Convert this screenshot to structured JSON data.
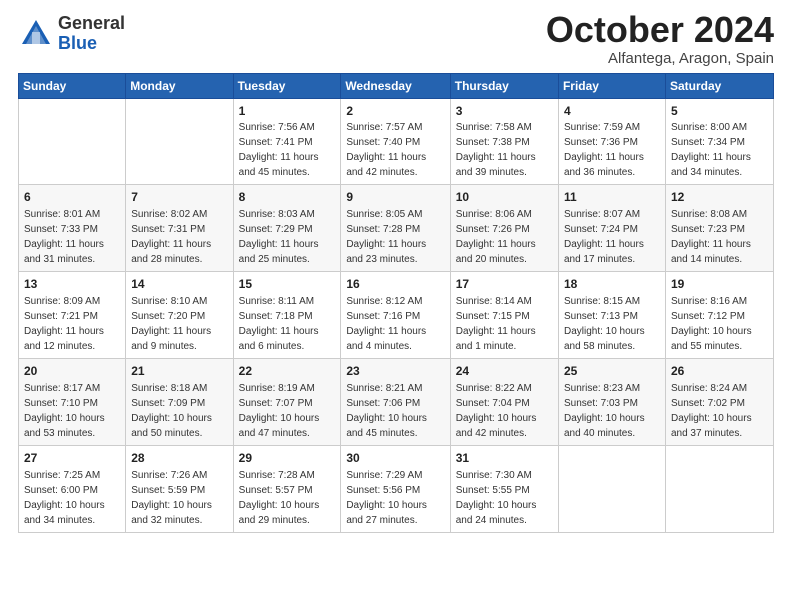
{
  "logo": {
    "general": "General",
    "blue": "Blue"
  },
  "header": {
    "month": "October 2024",
    "location": "Alfantega, Aragon, Spain"
  },
  "days_of_week": [
    "Sunday",
    "Monday",
    "Tuesday",
    "Wednesday",
    "Thursday",
    "Friday",
    "Saturday"
  ],
  "weeks": [
    [
      {
        "day": "",
        "info": ""
      },
      {
        "day": "",
        "info": ""
      },
      {
        "day": "1",
        "info": "Sunrise: 7:56 AM\nSunset: 7:41 PM\nDaylight: 11 hours and 45 minutes."
      },
      {
        "day": "2",
        "info": "Sunrise: 7:57 AM\nSunset: 7:40 PM\nDaylight: 11 hours and 42 minutes."
      },
      {
        "day": "3",
        "info": "Sunrise: 7:58 AM\nSunset: 7:38 PM\nDaylight: 11 hours and 39 minutes."
      },
      {
        "day": "4",
        "info": "Sunrise: 7:59 AM\nSunset: 7:36 PM\nDaylight: 11 hours and 36 minutes."
      },
      {
        "day": "5",
        "info": "Sunrise: 8:00 AM\nSunset: 7:34 PM\nDaylight: 11 hours and 34 minutes."
      }
    ],
    [
      {
        "day": "6",
        "info": "Sunrise: 8:01 AM\nSunset: 7:33 PM\nDaylight: 11 hours and 31 minutes."
      },
      {
        "day": "7",
        "info": "Sunrise: 8:02 AM\nSunset: 7:31 PM\nDaylight: 11 hours and 28 minutes."
      },
      {
        "day": "8",
        "info": "Sunrise: 8:03 AM\nSunset: 7:29 PM\nDaylight: 11 hours and 25 minutes."
      },
      {
        "day": "9",
        "info": "Sunrise: 8:05 AM\nSunset: 7:28 PM\nDaylight: 11 hours and 23 minutes."
      },
      {
        "day": "10",
        "info": "Sunrise: 8:06 AM\nSunset: 7:26 PM\nDaylight: 11 hours and 20 minutes."
      },
      {
        "day": "11",
        "info": "Sunrise: 8:07 AM\nSunset: 7:24 PM\nDaylight: 11 hours and 17 minutes."
      },
      {
        "day": "12",
        "info": "Sunrise: 8:08 AM\nSunset: 7:23 PM\nDaylight: 11 hours and 14 minutes."
      }
    ],
    [
      {
        "day": "13",
        "info": "Sunrise: 8:09 AM\nSunset: 7:21 PM\nDaylight: 11 hours and 12 minutes."
      },
      {
        "day": "14",
        "info": "Sunrise: 8:10 AM\nSunset: 7:20 PM\nDaylight: 11 hours and 9 minutes."
      },
      {
        "day": "15",
        "info": "Sunrise: 8:11 AM\nSunset: 7:18 PM\nDaylight: 11 hours and 6 minutes."
      },
      {
        "day": "16",
        "info": "Sunrise: 8:12 AM\nSunset: 7:16 PM\nDaylight: 11 hours and 4 minutes."
      },
      {
        "day": "17",
        "info": "Sunrise: 8:14 AM\nSunset: 7:15 PM\nDaylight: 11 hours and 1 minute."
      },
      {
        "day": "18",
        "info": "Sunrise: 8:15 AM\nSunset: 7:13 PM\nDaylight: 10 hours and 58 minutes."
      },
      {
        "day": "19",
        "info": "Sunrise: 8:16 AM\nSunset: 7:12 PM\nDaylight: 10 hours and 55 minutes."
      }
    ],
    [
      {
        "day": "20",
        "info": "Sunrise: 8:17 AM\nSunset: 7:10 PM\nDaylight: 10 hours and 53 minutes."
      },
      {
        "day": "21",
        "info": "Sunrise: 8:18 AM\nSunset: 7:09 PM\nDaylight: 10 hours and 50 minutes."
      },
      {
        "day": "22",
        "info": "Sunrise: 8:19 AM\nSunset: 7:07 PM\nDaylight: 10 hours and 47 minutes."
      },
      {
        "day": "23",
        "info": "Sunrise: 8:21 AM\nSunset: 7:06 PM\nDaylight: 10 hours and 45 minutes."
      },
      {
        "day": "24",
        "info": "Sunrise: 8:22 AM\nSunset: 7:04 PM\nDaylight: 10 hours and 42 minutes."
      },
      {
        "day": "25",
        "info": "Sunrise: 8:23 AM\nSunset: 7:03 PM\nDaylight: 10 hours and 40 minutes."
      },
      {
        "day": "26",
        "info": "Sunrise: 8:24 AM\nSunset: 7:02 PM\nDaylight: 10 hours and 37 minutes."
      }
    ],
    [
      {
        "day": "27",
        "info": "Sunrise: 7:25 AM\nSunset: 6:00 PM\nDaylight: 10 hours and 34 minutes."
      },
      {
        "day": "28",
        "info": "Sunrise: 7:26 AM\nSunset: 5:59 PM\nDaylight: 10 hours and 32 minutes."
      },
      {
        "day": "29",
        "info": "Sunrise: 7:28 AM\nSunset: 5:57 PM\nDaylight: 10 hours and 29 minutes."
      },
      {
        "day": "30",
        "info": "Sunrise: 7:29 AM\nSunset: 5:56 PM\nDaylight: 10 hours and 27 minutes."
      },
      {
        "day": "31",
        "info": "Sunrise: 7:30 AM\nSunset: 5:55 PM\nDaylight: 10 hours and 24 minutes."
      },
      {
        "day": "",
        "info": ""
      },
      {
        "day": "",
        "info": ""
      }
    ]
  ]
}
